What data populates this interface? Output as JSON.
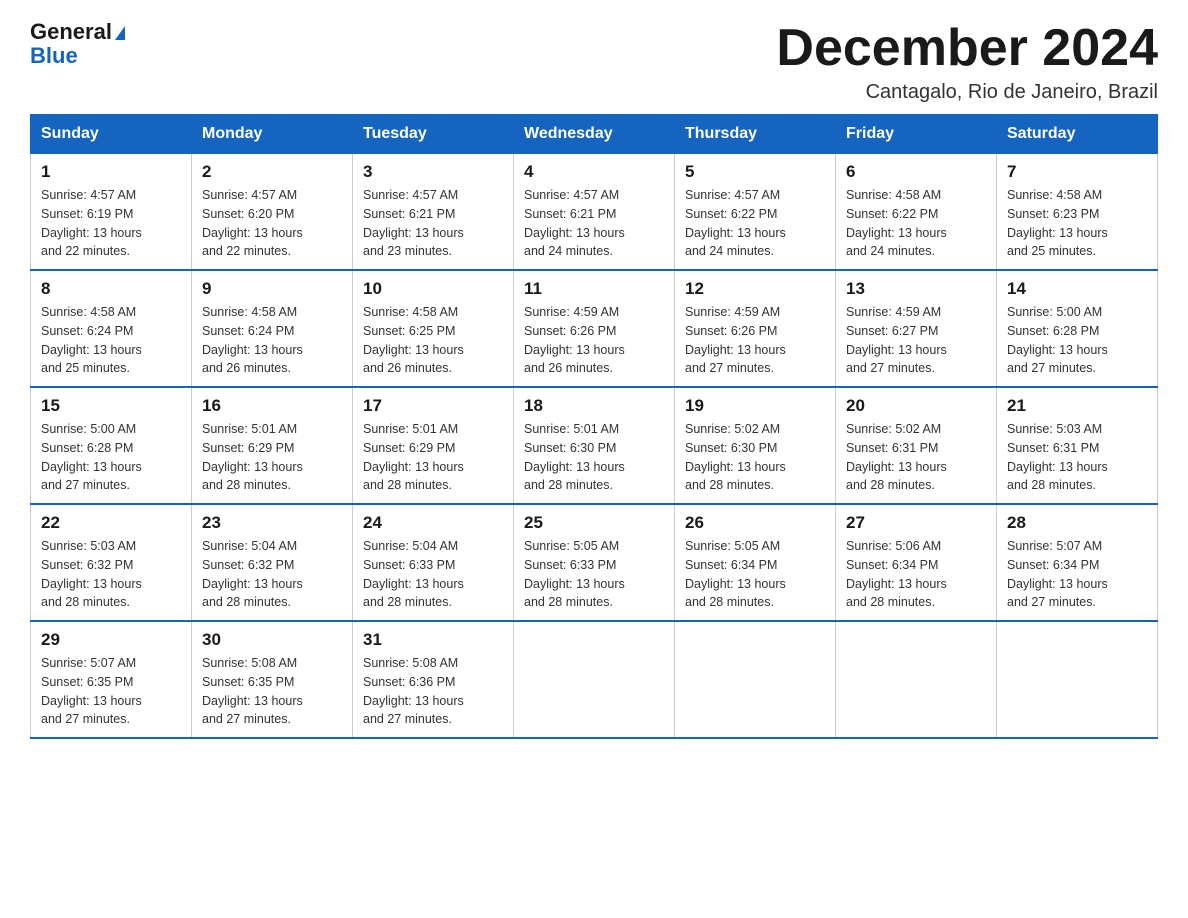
{
  "header": {
    "logo_general": "General",
    "logo_blue": "Blue",
    "month_title": "December 2024",
    "location": "Cantagalo, Rio de Janeiro, Brazil"
  },
  "weekdays": [
    "Sunday",
    "Monday",
    "Tuesday",
    "Wednesday",
    "Thursday",
    "Friday",
    "Saturday"
  ],
  "weeks": [
    [
      {
        "day": "1",
        "sunrise": "4:57 AM",
        "sunset": "6:19 PM",
        "daylight": "13 hours and 22 minutes."
      },
      {
        "day": "2",
        "sunrise": "4:57 AM",
        "sunset": "6:20 PM",
        "daylight": "13 hours and 22 minutes."
      },
      {
        "day": "3",
        "sunrise": "4:57 AM",
        "sunset": "6:21 PM",
        "daylight": "13 hours and 23 minutes."
      },
      {
        "day": "4",
        "sunrise": "4:57 AM",
        "sunset": "6:21 PM",
        "daylight": "13 hours and 24 minutes."
      },
      {
        "day": "5",
        "sunrise": "4:57 AM",
        "sunset": "6:22 PM",
        "daylight": "13 hours and 24 minutes."
      },
      {
        "day": "6",
        "sunrise": "4:58 AM",
        "sunset": "6:22 PM",
        "daylight": "13 hours and 24 minutes."
      },
      {
        "day": "7",
        "sunrise": "4:58 AM",
        "sunset": "6:23 PM",
        "daylight": "13 hours and 25 minutes."
      }
    ],
    [
      {
        "day": "8",
        "sunrise": "4:58 AM",
        "sunset": "6:24 PM",
        "daylight": "13 hours and 25 minutes."
      },
      {
        "day": "9",
        "sunrise": "4:58 AM",
        "sunset": "6:24 PM",
        "daylight": "13 hours and 26 minutes."
      },
      {
        "day": "10",
        "sunrise": "4:58 AM",
        "sunset": "6:25 PM",
        "daylight": "13 hours and 26 minutes."
      },
      {
        "day": "11",
        "sunrise": "4:59 AM",
        "sunset": "6:26 PM",
        "daylight": "13 hours and 26 minutes."
      },
      {
        "day": "12",
        "sunrise": "4:59 AM",
        "sunset": "6:26 PM",
        "daylight": "13 hours and 27 minutes."
      },
      {
        "day": "13",
        "sunrise": "4:59 AM",
        "sunset": "6:27 PM",
        "daylight": "13 hours and 27 minutes."
      },
      {
        "day": "14",
        "sunrise": "5:00 AM",
        "sunset": "6:28 PM",
        "daylight": "13 hours and 27 minutes."
      }
    ],
    [
      {
        "day": "15",
        "sunrise": "5:00 AM",
        "sunset": "6:28 PM",
        "daylight": "13 hours and 27 minutes."
      },
      {
        "day": "16",
        "sunrise": "5:01 AM",
        "sunset": "6:29 PM",
        "daylight": "13 hours and 28 minutes."
      },
      {
        "day": "17",
        "sunrise": "5:01 AM",
        "sunset": "6:29 PM",
        "daylight": "13 hours and 28 minutes."
      },
      {
        "day": "18",
        "sunrise": "5:01 AM",
        "sunset": "6:30 PM",
        "daylight": "13 hours and 28 minutes."
      },
      {
        "day": "19",
        "sunrise": "5:02 AM",
        "sunset": "6:30 PM",
        "daylight": "13 hours and 28 minutes."
      },
      {
        "day": "20",
        "sunrise": "5:02 AM",
        "sunset": "6:31 PM",
        "daylight": "13 hours and 28 minutes."
      },
      {
        "day": "21",
        "sunrise": "5:03 AM",
        "sunset": "6:31 PM",
        "daylight": "13 hours and 28 minutes."
      }
    ],
    [
      {
        "day": "22",
        "sunrise": "5:03 AM",
        "sunset": "6:32 PM",
        "daylight": "13 hours and 28 minutes."
      },
      {
        "day": "23",
        "sunrise": "5:04 AM",
        "sunset": "6:32 PM",
        "daylight": "13 hours and 28 minutes."
      },
      {
        "day": "24",
        "sunrise": "5:04 AM",
        "sunset": "6:33 PM",
        "daylight": "13 hours and 28 minutes."
      },
      {
        "day": "25",
        "sunrise": "5:05 AM",
        "sunset": "6:33 PM",
        "daylight": "13 hours and 28 minutes."
      },
      {
        "day": "26",
        "sunrise": "5:05 AM",
        "sunset": "6:34 PM",
        "daylight": "13 hours and 28 minutes."
      },
      {
        "day": "27",
        "sunrise": "5:06 AM",
        "sunset": "6:34 PM",
        "daylight": "13 hours and 28 minutes."
      },
      {
        "day": "28",
        "sunrise": "5:07 AM",
        "sunset": "6:34 PM",
        "daylight": "13 hours and 27 minutes."
      }
    ],
    [
      {
        "day": "29",
        "sunrise": "5:07 AM",
        "sunset": "6:35 PM",
        "daylight": "13 hours and 27 minutes."
      },
      {
        "day": "30",
        "sunrise": "5:08 AM",
        "sunset": "6:35 PM",
        "daylight": "13 hours and 27 minutes."
      },
      {
        "day": "31",
        "sunrise": "5:08 AM",
        "sunset": "6:36 PM",
        "daylight": "13 hours and 27 minutes."
      },
      null,
      null,
      null,
      null
    ]
  ],
  "labels": {
    "sunrise": "Sunrise:",
    "sunset": "Sunset:",
    "daylight": "Daylight:"
  }
}
